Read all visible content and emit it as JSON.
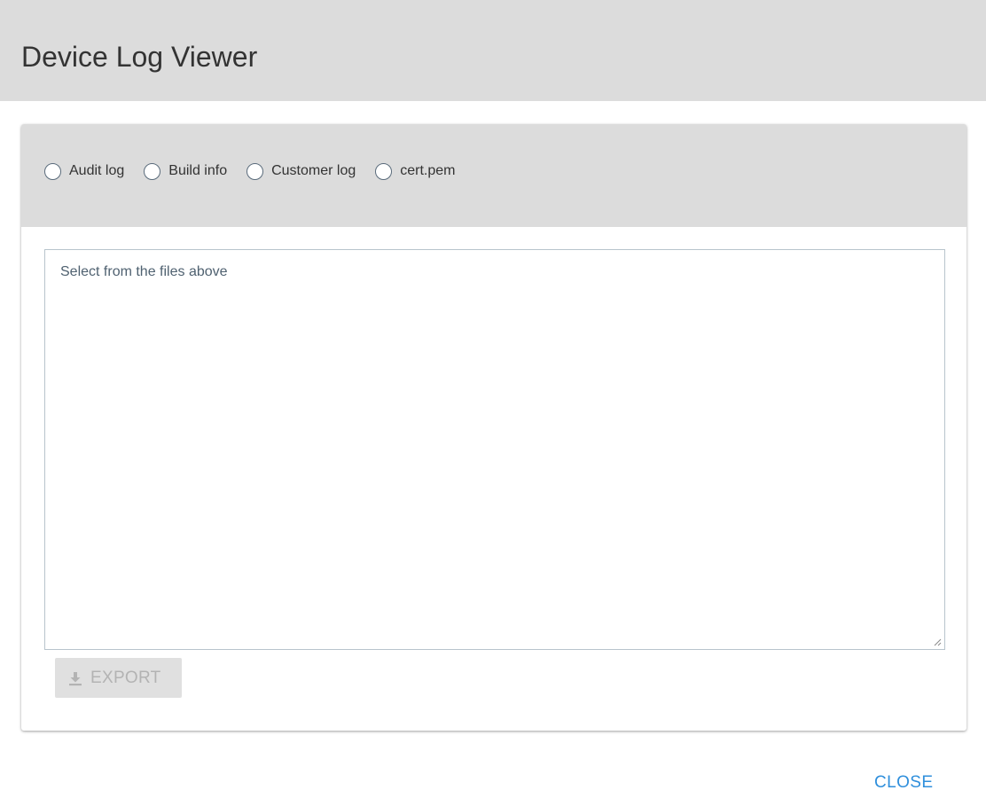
{
  "dialog": {
    "title": "Device Log Viewer",
    "close_label": "CLOSE",
    "accent_color": "#2f8fdc"
  },
  "files": {
    "options": [
      {
        "label": "Audit log",
        "selected": false
      },
      {
        "label": "Build info",
        "selected": false
      },
      {
        "label": "Customer log",
        "selected": false
      },
      {
        "label": "cert.pem",
        "selected": false
      }
    ]
  },
  "log_viewer": {
    "placeholder": "Select from the files above",
    "value": ""
  },
  "actions": {
    "export_label": "EXPORT",
    "export_enabled": false,
    "export_icon": "download-icon"
  }
}
